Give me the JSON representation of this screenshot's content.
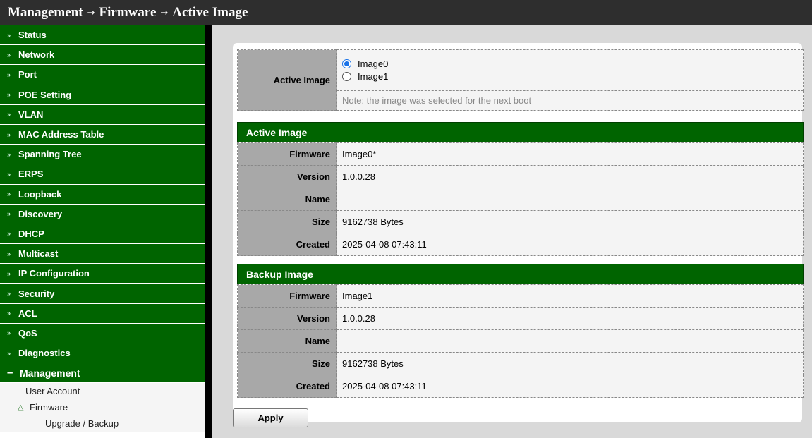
{
  "breadcrumb": {
    "items": [
      "Management",
      "Firmware",
      "Active Image"
    ],
    "separator": "→"
  },
  "sidebar": {
    "items": [
      {
        "label": "Status"
      },
      {
        "label": "Network"
      },
      {
        "label": "Port"
      },
      {
        "label": "POE Setting"
      },
      {
        "label": "VLAN"
      },
      {
        "label": "MAC Address Table"
      },
      {
        "label": "Spanning Tree"
      },
      {
        "label": "ERPS"
      },
      {
        "label": "Loopback"
      },
      {
        "label": "Discovery"
      },
      {
        "label": "DHCP"
      },
      {
        "label": "Multicast"
      },
      {
        "label": "IP Configuration"
      },
      {
        "label": "Security"
      },
      {
        "label": "ACL"
      },
      {
        "label": "QoS"
      },
      {
        "label": "Diagnostics"
      }
    ],
    "expanded": {
      "label": "Management",
      "icon": "minus-icon"
    },
    "sub_items": [
      {
        "label": "User Account"
      },
      {
        "label": "Firmware",
        "icon": "tree-expand-icon"
      },
      {
        "label": "Upgrade / Backup"
      }
    ],
    "collapsed_icon": "double-chevron-down-icon"
  },
  "active_image_select": {
    "label": "Active Image",
    "options": [
      "Image0",
      "Image1"
    ],
    "selected": "Image0",
    "note": "Note: the image was selected for the next boot"
  },
  "active_image": {
    "title": "Active Image",
    "rows": [
      {
        "label": "Firmware",
        "value": "Image0*"
      },
      {
        "label": "Version",
        "value": "1.0.0.28"
      },
      {
        "label": "Name",
        "value": ""
      },
      {
        "label": "Size",
        "value": "9162738 Bytes"
      },
      {
        "label": "Created",
        "value": "2025-04-08 07:43:11"
      }
    ]
  },
  "backup_image": {
    "title": "Backup Image",
    "rows": [
      {
        "label": "Firmware",
        "value": "Image1"
      },
      {
        "label": "Version",
        "value": "1.0.0.28"
      },
      {
        "label": "Name",
        "value": ""
      },
      {
        "label": "Size",
        "value": "9162738 Bytes"
      },
      {
        "label": "Created",
        "value": "2025-04-08 07:43:11"
      }
    ]
  },
  "actions": {
    "apply_label": "Apply"
  },
  "colors": {
    "menu_green": "#006400",
    "header_dark": "#2e2e2e",
    "label_gray": "#a8a8a8",
    "content_bg": "#d9d9d9"
  }
}
